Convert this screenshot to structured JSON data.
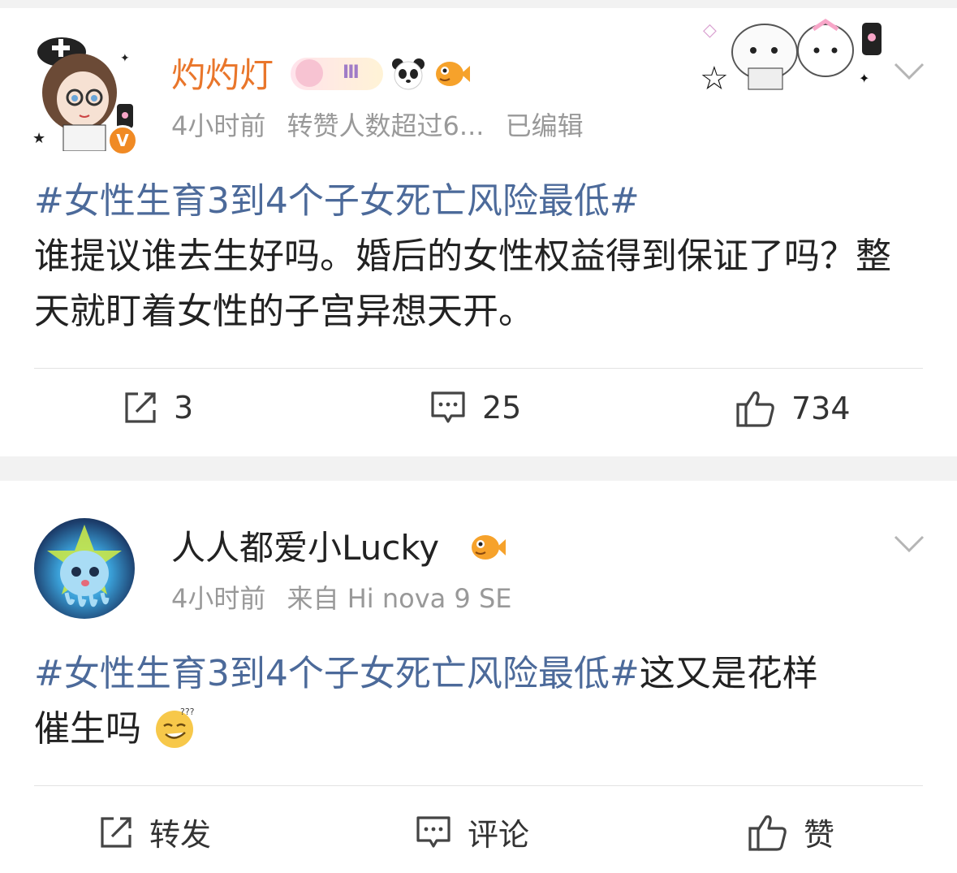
{
  "posts": [
    {
      "username": "灼灼灯",
      "meta": {
        "time": "4小时前",
        "extra": "转赞人数超过6...",
        "edited": "已编辑"
      },
      "text": {
        "tag": "#女性生育3到4个子女死亡风险最低#",
        "body": "谁提议谁去生好吗。婚后的女性权益得到保证了吗？整天就盯着女性的子宫异想天开。"
      },
      "actions": {
        "repost": "3",
        "comment": "25",
        "like": "734"
      },
      "colors": {
        "username": "#e9762b"
      }
    },
    {
      "username": "人人都爱小Lucky",
      "meta": {
        "time": "4小时前",
        "extra": "来自 Hi nova 9 SE"
      },
      "text": {
        "tag": "#女性生育3到4个子女死亡风险最低#",
        "body_line1": "这又是花样",
        "body_line2": "催生吗"
      },
      "actions": {
        "repost": "转发",
        "comment": "评论",
        "like": "赞"
      },
      "colors": {
        "username": "#222222"
      }
    }
  ],
  "colors": {
    "hashtag": "#4c6a9a",
    "meta": "#999999",
    "background": "#f2f2f2"
  },
  "icons": [
    "share-icon",
    "comment-icon",
    "thumbs-up-icon",
    "chevron-down-icon",
    "verified-badge-icon",
    "panda-icon",
    "fish-icon"
  ]
}
